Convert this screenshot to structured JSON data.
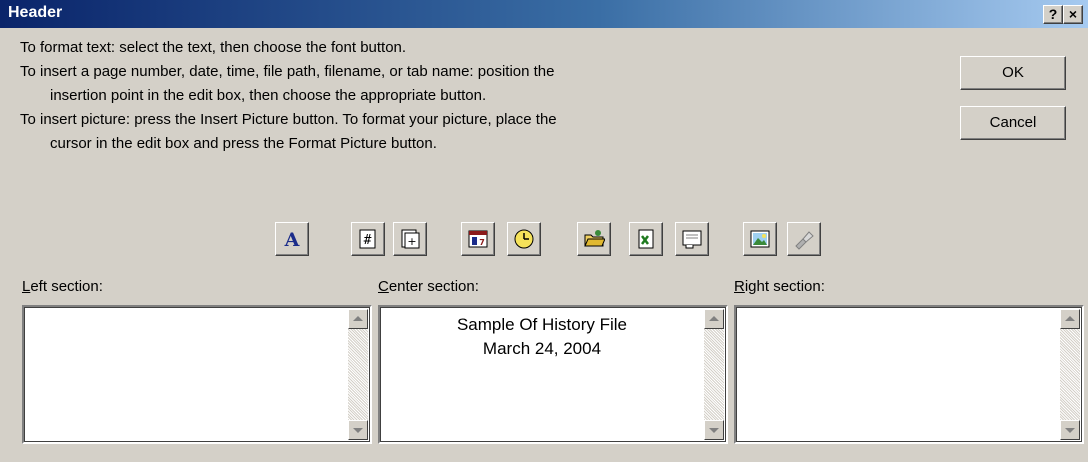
{
  "window": {
    "title": "Header",
    "help_button": "?",
    "close_button": "×"
  },
  "instructions": [
    "To format text:  select the text, then choose the font button.",
    "To insert a page number, date, time, file path, filename, or tab name:  position the",
    "insertion point in the edit box, then choose the appropriate button.",
    "To insert picture: press the Insert Picture button.  To format your picture, place the",
    "cursor in the edit box and press the Format Picture button."
  ],
  "buttons": {
    "ok": "OK",
    "cancel": "Cancel"
  },
  "toolbar": {
    "icons": [
      "font-icon",
      "page-number-icon",
      "total-pages-icon",
      "date-icon",
      "time-icon",
      "file-path-icon",
      "filename-icon",
      "sheet-name-icon",
      "insert-picture-icon",
      "format-picture-icon"
    ]
  },
  "sections": {
    "left": {
      "label_accel": "L",
      "label_rest": "eft section:",
      "text": ""
    },
    "center": {
      "label_accel": "C",
      "label_rest": "enter section:",
      "line1": "Sample Of History File",
      "line2": "March 24, 2004"
    },
    "right": {
      "label_accel": "R",
      "label_rest": "ight section:",
      "text": ""
    }
  },
  "colors": {
    "dialog_bg": "#d4d0c8",
    "titlebar_start": "#0a246a",
    "titlebar_end": "#a6caf0"
  }
}
